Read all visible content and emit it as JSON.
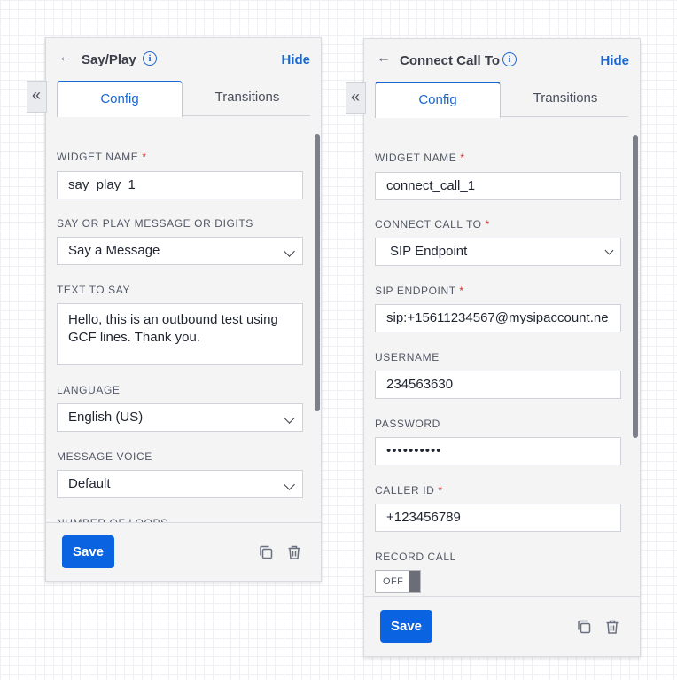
{
  "panel1": {
    "title": "Say/Play",
    "hide_label": "Hide",
    "collapse_glyph": "«",
    "tabs": [
      "Config",
      "Transitions"
    ],
    "widget_name_label": "WIDGET NAME",
    "widget_name_value": "say_play_1",
    "say_or_play_label": "SAY OR PLAY MESSAGE OR DIGITS",
    "say_or_play_value": "Say a Message",
    "text_to_say_label": "TEXT TO SAY",
    "text_to_say_value": "Hello, this is an outbound test using GCF lines. Thank you.",
    "language_label": "LANGUAGE",
    "language_value": "English (US)",
    "message_voice_label": "MESSAGE VOICE",
    "message_voice_value": "Default",
    "number_of_loops_label": "NUMBER OF LOOPS",
    "save_label": "Save"
  },
  "panel2": {
    "title": "Connect Call To",
    "hide_label": "Hide",
    "collapse_glyph": "«",
    "tabs": [
      "Config",
      "Transitions"
    ],
    "widget_name_label": "WIDGET NAME",
    "widget_name_value": "connect_call_1",
    "connect_call_to_label": "CONNECT CALL TO",
    "connect_call_to_value": "SIP Endpoint",
    "sip_endpoint_label": "SIP ENDPOINT",
    "sip_endpoint_value": "sip:+15611234567@mysipaccount.ne",
    "username_label": "USERNAME",
    "username_value": "234563630",
    "password_label": "PASSWORD",
    "password_value": "••••••••••",
    "caller_id_label": "CALLER ID",
    "caller_id_value": "+123456789",
    "record_call_label": "RECORD CALL",
    "record_call_toggle": "OFF",
    "save_label": "Save"
  },
  "required_marker": "*",
  "icons": {
    "back": "arrow-left-icon",
    "info": "info-icon",
    "collapse": "double-chevron-left-icon",
    "duplicate": "copy-icon",
    "delete": "trash-icon",
    "dropdown": "chevron-down-icon"
  },
  "colors": {
    "accent": "#1a67d2",
    "save_button": "#0a63e0",
    "required": "#d32a2a",
    "panel_bg": "#f4f4f4"
  }
}
